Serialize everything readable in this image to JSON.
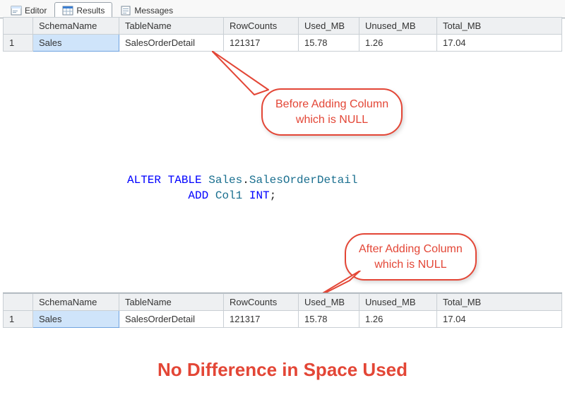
{
  "tabs": {
    "editor": "Editor",
    "results": "Results",
    "messages": "Messages",
    "active": "results"
  },
  "columns": {
    "rownum": "",
    "schema": "SchemaName",
    "table": "TableName",
    "rowcounts": "RowCounts",
    "used": "Used_MB",
    "unused": "Unused_MB",
    "total": "Total_MB"
  },
  "before_row": {
    "n": "1",
    "schema": "Sales",
    "table": "SalesOrderDetail",
    "rowcounts": "121317",
    "used": "15.78",
    "unused": "1.26",
    "total": "17.04"
  },
  "after_row": {
    "n": "1",
    "schema": "Sales",
    "table": "SalesOrderDetail",
    "rowcounts": "121317",
    "used": "15.78",
    "unused": "1.26",
    "total": "17.04"
  },
  "callouts": {
    "before_l1": "Before Adding Column",
    "before_l2": "which is NULL",
    "after_l1": "After Adding Column",
    "after_l2": "which is NULL"
  },
  "sql": {
    "kw_alter": "ALTER TABLE",
    "schema": " Sales",
    "dot": ".",
    "table": "SalesOrderDetail",
    "kw_add": "ADD",
    "col": " Col1 ",
    "type": "INT",
    "semi": ";"
  },
  "caption": "No Difference in Space Used"
}
